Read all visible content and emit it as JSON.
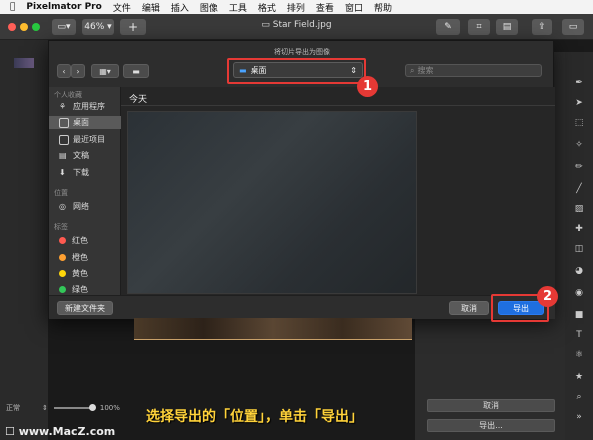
{
  "menubar": {
    "app": "Pixelmator Pro",
    "items": [
      "文件",
      "编辑",
      "插入",
      "图像",
      "工具",
      "格式",
      "排列",
      "查看",
      "窗口",
      "帮助"
    ]
  },
  "toolbar": {
    "zoom": "46%",
    "add": "+",
    "document_title": "Star Field.jpg"
  },
  "dialog": {
    "title": "将切片导出为图像",
    "location": "桌面",
    "search_placeholder": "搜索",
    "sidebar": {
      "favorites_header": "个人收藏",
      "favorites": [
        "应用程序",
        "桌面",
        "最近项目",
        "文稿",
        "下载"
      ],
      "locations_header": "位置",
      "locations": [
        "网络"
      ],
      "tags_header": "标签",
      "tags": [
        {
          "label": "红色",
          "color": "#ff5a50"
        },
        {
          "label": "橙色",
          "color": "#ffa032"
        },
        {
          "label": "黄色",
          "color": "#ffd60a"
        },
        {
          "label": "绿色",
          "color": "#33c759"
        }
      ]
    },
    "group_label": "今天",
    "new_folder": "新建文件夹",
    "cancel": "取消",
    "export": "导出"
  },
  "annotations": {
    "badge1": "1",
    "badge2": "2",
    "caption": "选择导出的「位置」，单击「导出」"
  },
  "panel": {
    "cancel": "取消",
    "export_more": "导出..."
  },
  "bottom": {
    "blend_mode": "正常",
    "zoom_percent": "100%",
    "watermark": "www.MacZ.com"
  },
  "colors": {
    "accent": "#1f6fe0",
    "highlight": "#e53935",
    "caption": "#ffd23a"
  }
}
